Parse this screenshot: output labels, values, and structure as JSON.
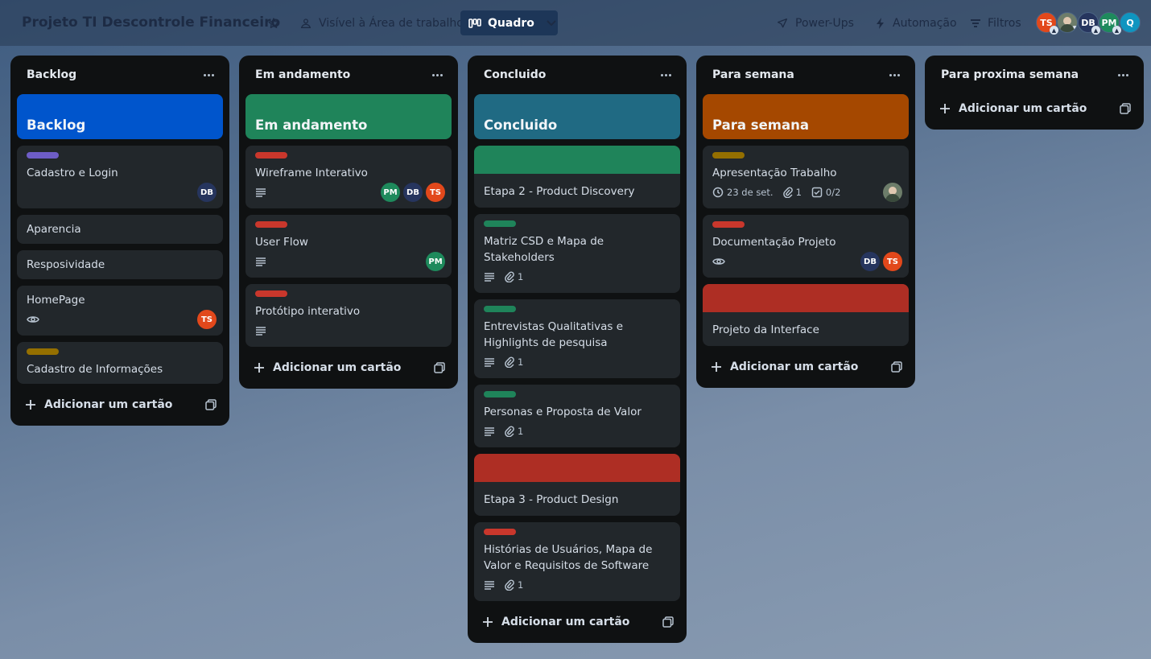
{
  "board": {
    "title": "Projeto TI Descontrole Financeiro",
    "visibility": "Visível à Área de trabalho",
    "view": "Quadro",
    "power_ups": "Power-Ups",
    "automation": "Automação",
    "filters": "Filtros",
    "members": [
      "TS",
      "DB",
      "PM",
      "Q"
    ]
  },
  "add_card_label": "Adicionar um cartão",
  "lists": [
    {
      "title": "Backlog",
      "cover_card": {
        "title": "Backlog",
        "color": "#0055cc"
      },
      "cards": [
        {
          "label_color": "#6e5dc6",
          "title": "Cadastro e Login",
          "members": [
            "DB"
          ]
        },
        {
          "title": "Aparencia"
        },
        {
          "title": "Resposividade"
        },
        {
          "title": "HomePage",
          "watch": true,
          "members": [
            "TS"
          ]
        },
        {
          "label_color": "#946f00",
          "title": "Cadastro de Informações"
        }
      ]
    },
    {
      "title": "Em andamento",
      "cover_card": {
        "title": "Em andamento",
        "color": "#1f845a"
      },
      "cards": [
        {
          "label_color": "#c9372c",
          "title": "Wireframe Interativo",
          "description": true,
          "members": [
            "PM",
            "DB",
            "TS"
          ]
        },
        {
          "label_color": "#c9372c",
          "title": "User Flow",
          "description": true,
          "members": [
            "PM"
          ]
        },
        {
          "label_color": "#c9372c",
          "title": "Protótipo interativo",
          "description": true
        }
      ]
    },
    {
      "title": "Concluido",
      "cover_card": {
        "title": "Concluido",
        "color": "#206a83"
      },
      "cards": [
        {
          "cover_color": "#1f845a",
          "title": "Etapa 2 - Product Discovery"
        },
        {
          "label_color": "#1f845a",
          "title": "Matriz CSD e Mapa de Stakeholders",
          "description": true,
          "attachments": "1"
        },
        {
          "label_color": "#1f845a",
          "title": "Entrevistas Qualitativas e Highlights de pesquisa",
          "description": true,
          "attachments": "1"
        },
        {
          "label_color": "#1f845a",
          "title": "Personas e Proposta de Valor",
          "description": true,
          "attachments": "1"
        },
        {
          "cover_color": "#ae2e24",
          "title": "Etapa 3 - Product Design"
        },
        {
          "label_color": "#c9372c",
          "title": "Histórias de Usuários, Mapa de Valor e Requisitos de Software",
          "description": true,
          "attachments": "1"
        }
      ]
    },
    {
      "title": "Para semana",
      "cover_card": {
        "title": "Para semana",
        "color": "#a54800"
      },
      "cards": [
        {
          "label_color": "#946f00",
          "title": "Apresentação Trabalho",
          "due": "23 de set.",
          "attachments": "1",
          "checklist": "0/2",
          "members": [
            "photo"
          ]
        },
        {
          "label_color": "#c9372c",
          "title": "Documentação Projeto",
          "watch": true,
          "members": [
            "DB",
            "TS"
          ]
        },
        {
          "cover_color": "#ae2e24",
          "title": "Projeto da Interface"
        }
      ]
    },
    {
      "title": "Para proxima semana",
      "cards": []
    }
  ],
  "colors": {
    "TS": "#e2481b",
    "DB": "#26355e",
    "PM": "#1e8a5c",
    "Q": "#0f95c0"
  }
}
